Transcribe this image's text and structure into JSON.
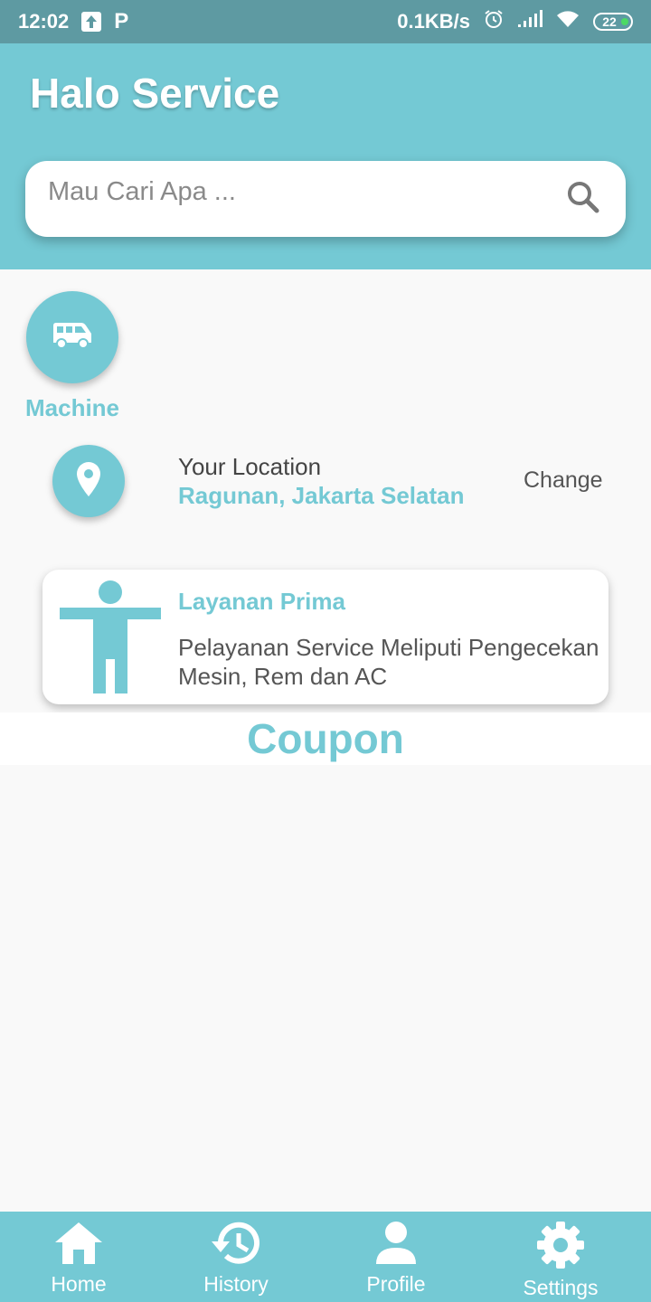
{
  "status_bar": {
    "time": "12:02",
    "network_speed": "0.1KB/s",
    "battery": "22",
    "icons": [
      "upload-icon",
      "parking-icon",
      "alarm-icon",
      "signal-icon",
      "wifi-icon",
      "battery-icon"
    ]
  },
  "header": {
    "title": "Halo Service"
  },
  "search": {
    "placeholder": "Mau Cari Apa ...",
    "value": "",
    "icon": "search-icon"
  },
  "categories": [
    {
      "label": "Machine",
      "icon": "van-icon"
    }
  ],
  "location": {
    "caption": "Your Location",
    "value": "Ragunan, Jakarta Selatan",
    "change_label": "Change",
    "icon": "location-pin-icon"
  },
  "service_card": {
    "title": "Layanan Prima",
    "description_line1": "Pelayanan Service Meliputi Pengecekan",
    "description_line2": "Mesin, Rem dan AC",
    "icon": "person-icon"
  },
  "coupon": {
    "title": "Coupon"
  },
  "bottom_nav": {
    "items": [
      {
        "label": "Home",
        "icon": "home-icon"
      },
      {
        "label": "History",
        "icon": "history-icon"
      },
      {
        "label": "Profile",
        "icon": "profile-icon"
      },
      {
        "label": "Settings",
        "icon": "settings-icon"
      }
    ]
  },
  "colors": {
    "primary": "#74c9d4",
    "status_bar": "#5e9aa2",
    "background": "#f9f9f9"
  }
}
